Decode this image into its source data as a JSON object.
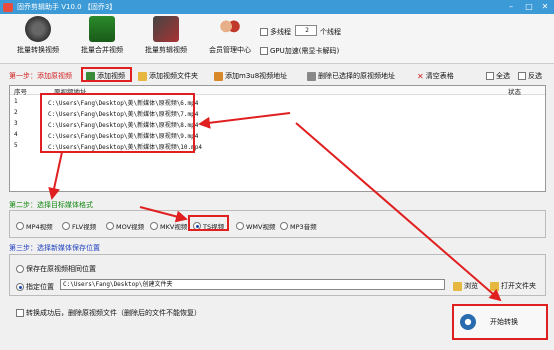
{
  "window": {
    "title": "固乔剪辑助手 V10.0 【固乔3】"
  },
  "toolbar": {
    "buttons": [
      {
        "label": "批量转换视频",
        "icon": "film-reel-icon"
      },
      {
        "label": "批量合并视频",
        "icon": "merge-video-icon"
      },
      {
        "label": "批量剪辑视频",
        "icon": "clapperboard-icon"
      },
      {
        "label": "会员管理中心",
        "icon": "users-icon"
      }
    ],
    "multithread_label": "多线程",
    "thread_count": "2",
    "thread_unit": "个线程",
    "gpu_label": "GPU加速(需显卡解码)"
  },
  "step1": {
    "label": "第一步：添加原视频",
    "add_video": "添加视频",
    "add_folder": "添加视频文件夹",
    "add_m3u8": "添加m3u8视频地址",
    "delete_selected": "删除已选择的原视频地址",
    "clear_table": "清空表格",
    "select_all": "全选",
    "invert": "反选"
  },
  "table": {
    "headers": [
      "序号",
      "原视频地址",
      "状态"
    ],
    "rows": [
      {
        "num": "1",
        "path": "C:\\Users\\Fang\\Desktop\\美\\新媒体\\原视频\\6.mp4"
      },
      {
        "num": "2",
        "path": "C:\\Users\\Fang\\Desktop\\美\\新媒体\\原视频\\7.mp4"
      },
      {
        "num": "3",
        "path": "C:\\Users\\Fang\\Desktop\\美\\新媒体\\原视频\\8.mp4"
      },
      {
        "num": "4",
        "path": "C:\\Users\\Fang\\Desktop\\美\\新媒体\\原视频\\9.mp4"
      },
      {
        "num": "5",
        "path": "C:\\Users\\Fang\\Desktop\\美\\新媒体\\原视频\\10.mp4"
      }
    ]
  },
  "step2": {
    "label": "第二步：选择目标媒体格式",
    "formats": [
      "MP4视频",
      "FLV视频",
      "MOV视频",
      "MKV视频",
      "TS视频",
      "WMV视频",
      "MP3音频"
    ],
    "selected": "TS视频"
  },
  "step3": {
    "label": "第三步：选择新媒体保存位置",
    "save_same": "保存在原视频相同位置",
    "specify": "指定位置",
    "path": "C:\\Users\\Fang\\Desktop\\创建文件夹",
    "browse": "浏览",
    "open_folder": "打开文件夹"
  },
  "bottom": {
    "delete_after": "转换成功后，删除原视频文件（删除后的文件不能恢复）",
    "start": "开始转换"
  },
  "colors": {
    "accent": "#3c9ad6",
    "highlight": "#e02020"
  }
}
